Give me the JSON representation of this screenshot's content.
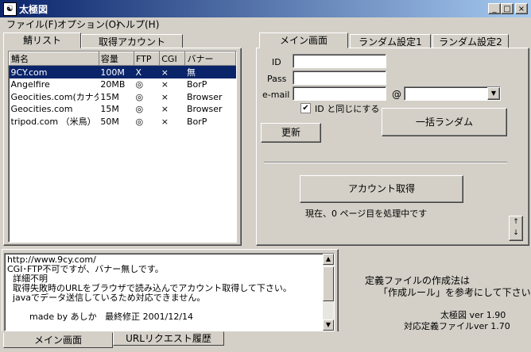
{
  "window": {
    "title": "太極図",
    "icon_glyph": "☯"
  },
  "menu": [
    "ファイル(F)",
    "オプション(O)",
    "ヘルプ(H)"
  ],
  "left_tabs": [
    "鯖リスト",
    "取得アカウント"
  ],
  "table": {
    "headers": [
      "鯖名",
      "容量",
      "FTP",
      "CGI",
      "バナー"
    ],
    "rows": [
      [
        "9CY.com",
        "100M",
        "X",
        "×",
        "無"
      ],
      [
        "Angelfire",
        "20MB",
        "◎",
        "×",
        "BorP"
      ],
      [
        "Geocities.com(カナダ)",
        "15M",
        "◎",
        "×",
        "Browser"
      ],
      [
        "Geocities.com",
        "15M",
        "◎",
        "×",
        "Browser"
      ],
      [
        "tripod.com （米鳥）",
        "50M",
        "◎",
        "×",
        "BorP"
      ]
    ],
    "selected_row": 0
  },
  "right_tabs": [
    "メイン画面",
    "ランダム設定1",
    "ランダム設定2"
  ],
  "form": {
    "id_label": "ID",
    "pass_label": "Pass",
    "email_label": "e-mail",
    "at_sign": "@",
    "same_as_id_label": "ID と同じにする",
    "same_as_id_checked": true,
    "update_button": "更新",
    "bulk_random_button": "一括ランダム",
    "get_account_button": "アカウント取得",
    "status": "現在、0 ページ目を処理中です"
  },
  "info_text": [
    "http://www.9cy.com/",
    "CGI･FTP不可ですが、バナー無しです。",
    "  詳細不明",
    "  取得失敗時のURLをブラウザで読み込んでアカウント取得して下さい。",
    "  javaでデータ送信しているため対応できません。",
    "",
    "        made by あしか   最終修正 2001/12/14"
  ],
  "right_info": {
    "line1": "定義ファイルの作成法は",
    "line2": "「作成ルール」を参考にして下さい",
    "version": "太極図  ver 1.90",
    "def_version": "対応定義ファイルver 1.70"
  },
  "bottom_tabs": [
    "メイン画面",
    "URLリクエスト履歴"
  ]
}
